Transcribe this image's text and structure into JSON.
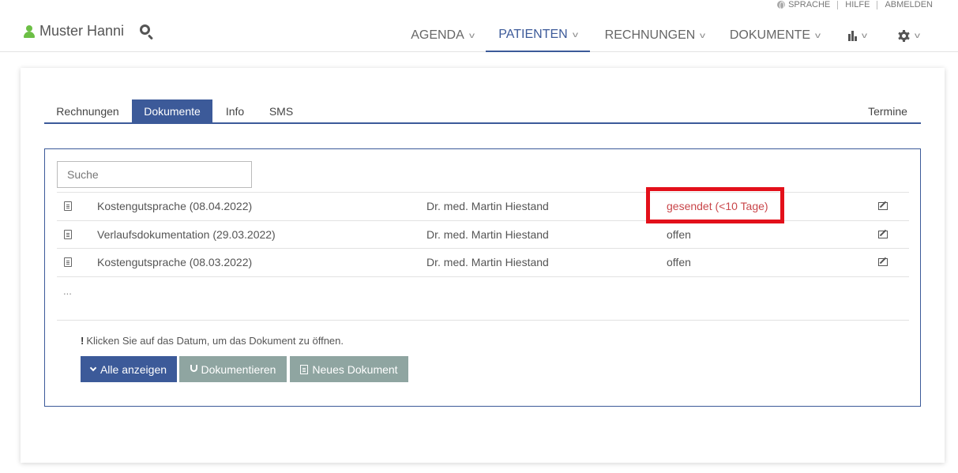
{
  "utility": {
    "language": "SPRACHE",
    "help": "HILFE",
    "logout": "ABMELDEN"
  },
  "user": {
    "name": "Muster Hanni"
  },
  "nav": {
    "items": [
      {
        "label": "AGENDA"
      },
      {
        "label": "PATIENTEN",
        "active": true
      },
      {
        "label": "RECHNUNGEN"
      },
      {
        "label": "DOKUMENTE"
      }
    ]
  },
  "tabs": {
    "items": [
      {
        "label": "Rechnungen"
      },
      {
        "label": "Dokumente",
        "active": true
      },
      {
        "label": "Info"
      },
      {
        "label": "SMS"
      }
    ],
    "right": "Termine"
  },
  "search": {
    "placeholder": "Suche"
  },
  "documents": [
    {
      "name": "Kostengutsprache (08.04.2022)",
      "author": "Dr. med. Martin Hiestand",
      "status": "gesendet (<10 Tage)",
      "status_color": "#c9464a"
    },
    {
      "name": "Verlaufsdokumentation (29.03.2022)",
      "author": "Dr. med. Martin Hiestand",
      "status": "offen"
    },
    {
      "name": "Kostengutsprache (08.03.2022)",
      "author": "Dr. med. Martin Hiestand",
      "status": "offen"
    }
  ],
  "more": "...",
  "hint": "Klicken Sie auf das Datum, um das Dokument zu öffnen.",
  "buttons": {
    "show_all": "Alle anzeigen",
    "document": "Dokumentieren",
    "new_document": "Neues Dokument"
  },
  "colors": {
    "primary": "#3c5a99",
    "muted_button": "#8fa5a1",
    "user_icon": "#6cbf45",
    "highlight": "#e3101a"
  }
}
